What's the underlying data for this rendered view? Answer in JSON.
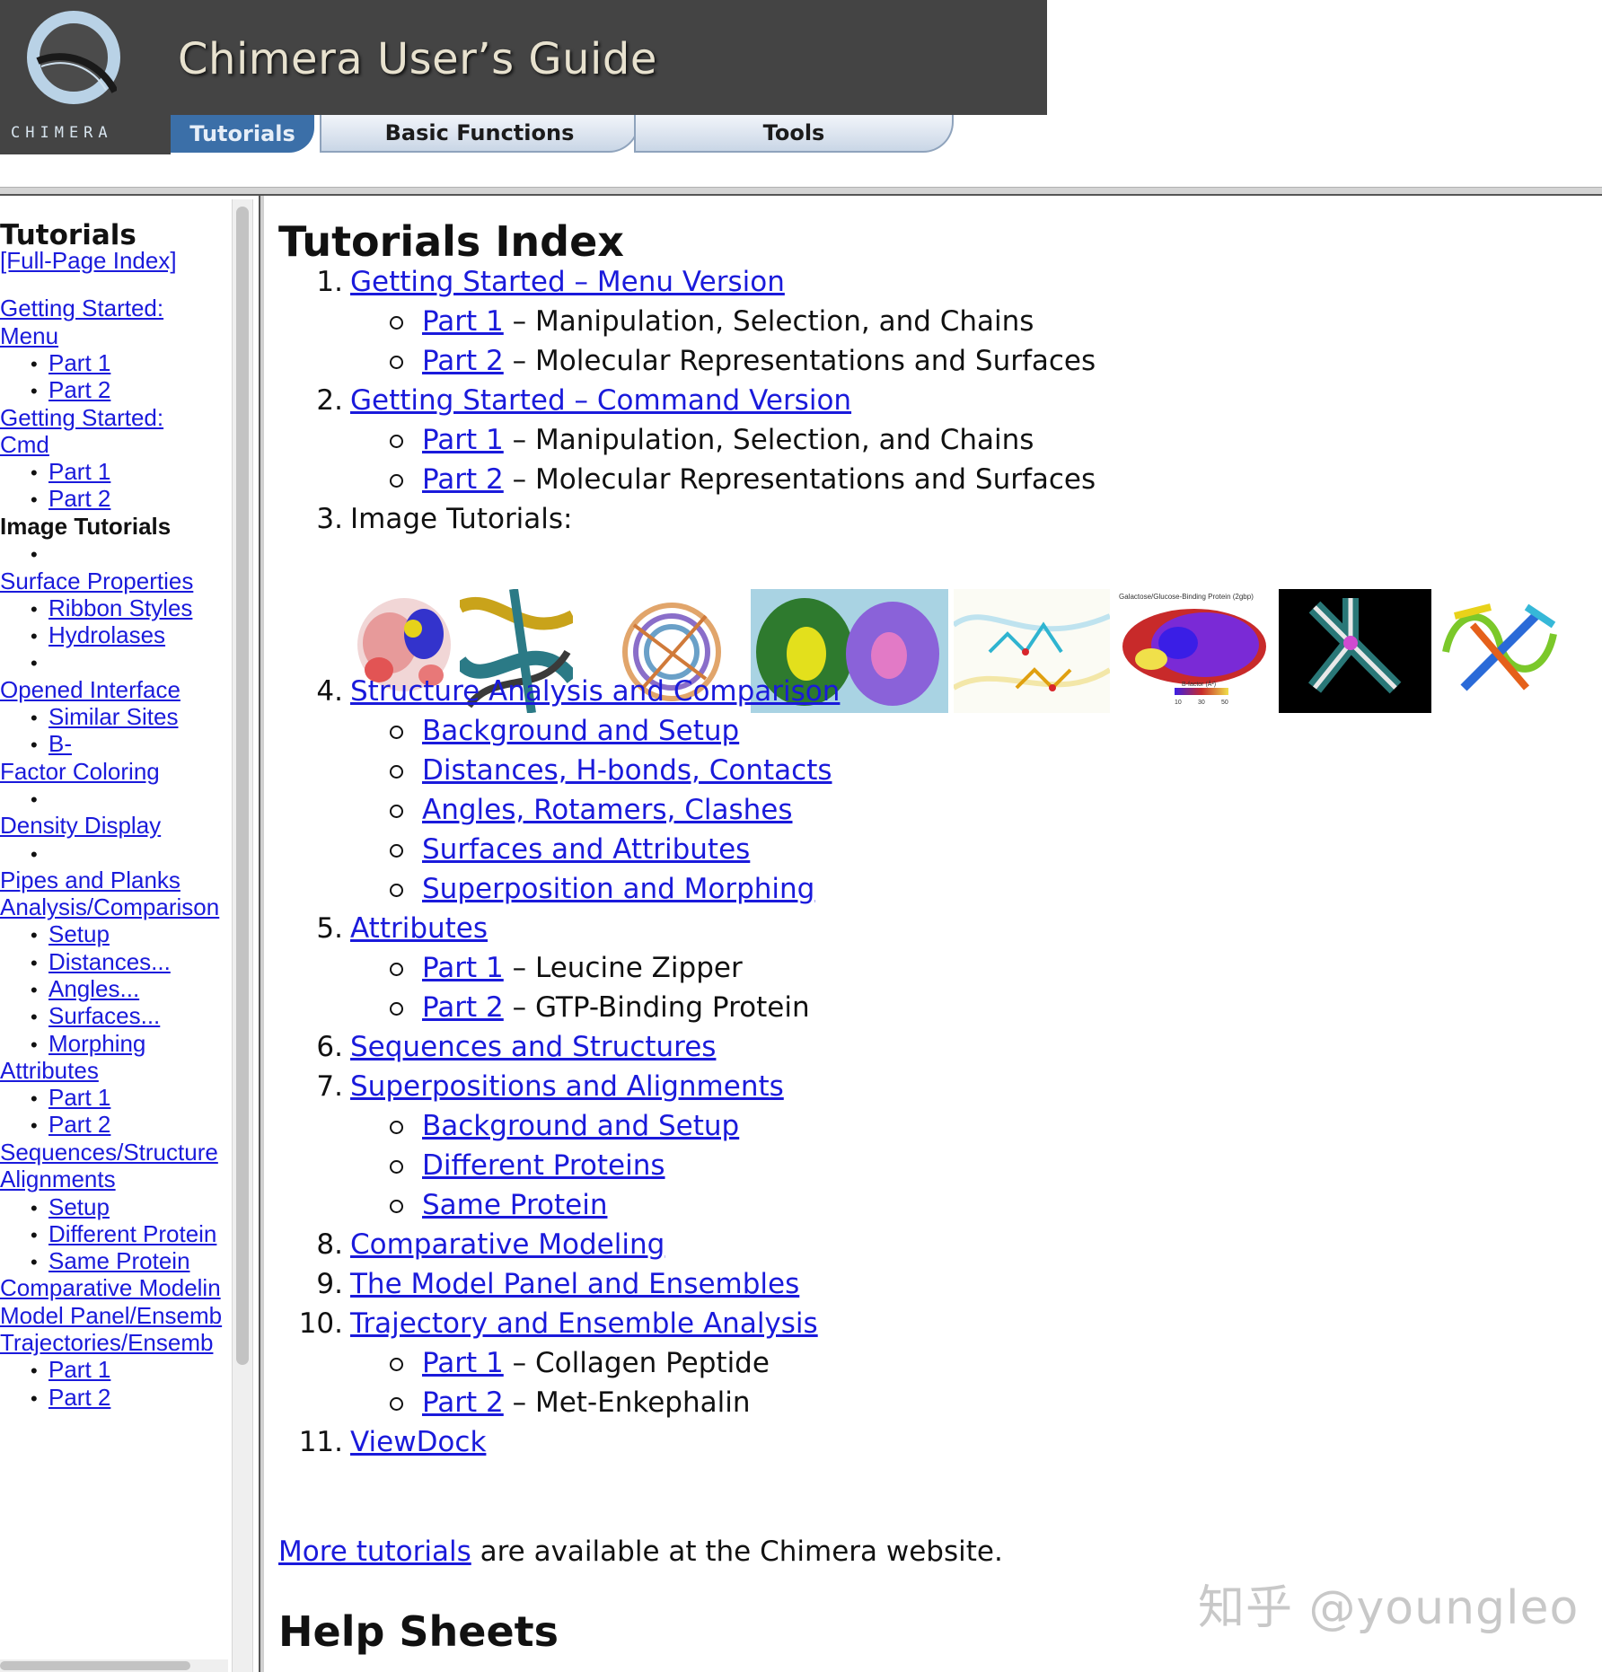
{
  "banner": {
    "logo_text": "CHIMERA",
    "title": "Chimera User’s Guide",
    "tabs": [
      {
        "label": "Tutorials",
        "active": true
      },
      {
        "label": "Basic Functions",
        "active": false
      },
      {
        "label": "Tools",
        "active": false
      }
    ]
  },
  "sidebar": {
    "title": "Tutorials",
    "entries": [
      {
        "text": "[Full-Page Index]",
        "kind": "link"
      },
      {
        "text": "Getting Started:",
        "kind": "link"
      },
      {
        "text": "Menu",
        "kind": "link"
      },
      {
        "text": "Part 1",
        "kind": "sublink"
      },
      {
        "text": "Part 2",
        "kind": "sublink"
      },
      {
        "text": "Getting Started:",
        "kind": "link"
      },
      {
        "text": "Cmd",
        "kind": "link"
      },
      {
        "text": "Part 1",
        "kind": "sublink"
      },
      {
        "text": "Part 2",
        "kind": "sublink"
      },
      {
        "text": "Image Tutorials",
        "kind": "bold"
      },
      {
        "text": "",
        "kind": "bullet"
      },
      {
        "text": "Surface Properties",
        "kind": "link"
      },
      {
        "text": "Ribbon Styles",
        "kind": "sublink"
      },
      {
        "text": "Hydrolases",
        "kind": "sublink"
      },
      {
        "text": "",
        "kind": "bullet"
      },
      {
        "text": "Opened Interface",
        "kind": "link"
      },
      {
        "text": "Similar Sites",
        "kind": "sublink"
      },
      {
        "text": "B-",
        "kind": "sublink"
      },
      {
        "text": "Factor Coloring",
        "kind": "link"
      },
      {
        "text": "",
        "kind": "bullet"
      },
      {
        "text": "Density Display",
        "kind": "link"
      },
      {
        "text": "",
        "kind": "bullet"
      },
      {
        "text": "Pipes and Planks",
        "kind": "link"
      },
      {
        "text": "Analysis/Comparison",
        "kind": "link"
      },
      {
        "text": "Setup",
        "kind": "sublink"
      },
      {
        "text": "Distances...",
        "kind": "sublink"
      },
      {
        "text": "Angles...",
        "kind": "sublink"
      },
      {
        "text": "Surfaces...",
        "kind": "sublink"
      },
      {
        "text": "Morphing",
        "kind": "sublink"
      },
      {
        "text": "Attributes",
        "kind": "link"
      },
      {
        "text": "Part 1",
        "kind": "sublink"
      },
      {
        "text": "Part 2",
        "kind": "sublink"
      },
      {
        "text": "Sequences/Structure",
        "kind": "link"
      },
      {
        "text": "Alignments",
        "kind": "link"
      },
      {
        "text": "Setup",
        "kind": "sublink"
      },
      {
        "text": "Different Protein",
        "kind": "sublink"
      },
      {
        "text": "Same Protein",
        "kind": "sublink"
      },
      {
        "text": "Comparative Modelin",
        "kind": "link"
      },
      {
        "text": "Model Panel/Ensemb",
        "kind": "link"
      },
      {
        "text": "Trajectories/Ensemb",
        "kind": "link"
      },
      {
        "text": "Part 1",
        "kind": "sublink"
      },
      {
        "text": "Part 2",
        "kind": "sublink"
      }
    ]
  },
  "main": {
    "title": "Tutorials Index",
    "items": [
      {
        "num": "1.",
        "link": "Getting Started – Menu Version",
        "subs": [
          {
            "link": "Part 1",
            "text": " – Manipulation, Selection, and Chains"
          },
          {
            "link": "Part 2",
            "text": " – Molecular Representations and Surfaces"
          }
        ]
      },
      {
        "num": "2.",
        "link": "Getting Started – Command Version",
        "subs": [
          {
            "link": "Part 1",
            "text": " – Manipulation, Selection, and Chains"
          },
          {
            "link": "Part 2",
            "text": " – Molecular Representations and Surfaces"
          }
        ]
      },
      {
        "num": "3.",
        "text": "Image Tutorials:",
        "subs": []
      },
      {
        "num": "4.",
        "link": "Structure Analysis and Comparison",
        "subs": [
          {
            "link": "Background and Setup",
            "text": ""
          },
          {
            "link": "Distances, H-bonds, Contacts",
            "text": ""
          },
          {
            "link": "Angles, Rotamers, Clashes",
            "text": ""
          },
          {
            "link": "Surfaces and Attributes",
            "text": ""
          },
          {
            "link": "Superposition and Morphing",
            "text": ""
          }
        ]
      },
      {
        "num": "5.",
        "link": "Attributes",
        "subs": [
          {
            "link": "Part 1",
            "text": " – Leucine Zipper"
          },
          {
            "link": "Part 2",
            "text": " – GTP-Binding Protein"
          }
        ]
      },
      {
        "num": "6.",
        "link": "Sequences and Structures",
        "subs": []
      },
      {
        "num": "7.",
        "link": "Superpositions and Alignments",
        "subs": [
          {
            "link": "Background and Setup",
            "text": ""
          },
          {
            "link": "Different Proteins",
            "text": ""
          },
          {
            "link": "Same Protein",
            "text": ""
          }
        ]
      },
      {
        "num": "8.",
        "link": "Comparative Modeling",
        "subs": []
      },
      {
        "num": "9.",
        "link": "The Model Panel and Ensembles",
        "subs": []
      },
      {
        "num": "10.",
        "link": "Trajectory and Ensemble Analysis",
        "subs": [
          {
            "link": "Part 1",
            "text": " – Collagen Peptide"
          },
          {
            "link": "Part 2",
            "text": " – Met-Enkephalin"
          }
        ]
      },
      {
        "num": "11.",
        "link": "ViewDock",
        "subs": []
      }
    ],
    "thumbnail_captions": {
      "gbp": "Galactose/Glucose-Binding Protein (2gbp)",
      "bfactor": "B-factor (Å²)",
      "ticks": [
        "10",
        "30",
        "50"
      ]
    },
    "more_link": "More tutorials",
    "more_text": " are available at the Chimera website.",
    "help_title": "Help Sheets"
  },
  "watermark": "知乎 @youngleo",
  "colors": {
    "link": "#1a1adb",
    "banner": "#444444",
    "active_tab": "#3b6fa8"
  }
}
